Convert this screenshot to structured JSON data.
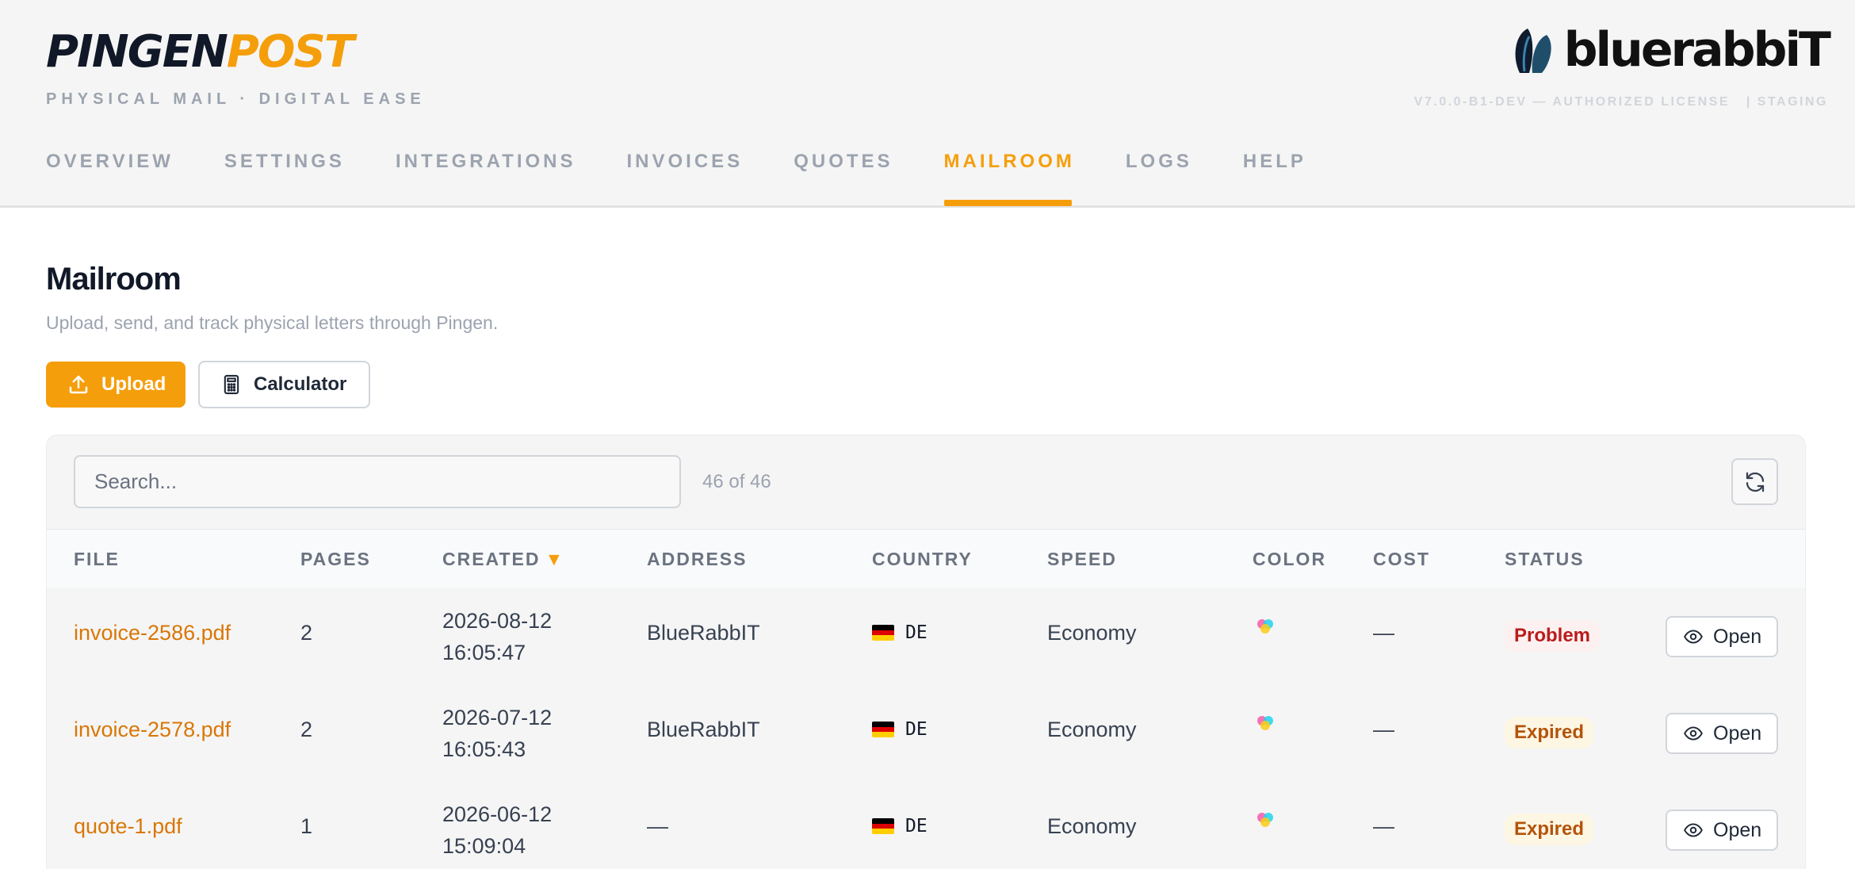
{
  "brand": {
    "part1": "PINGEN",
    "part2": "POST",
    "tagline": "PHYSICAL MAIL · DIGITAL EASE"
  },
  "logo": {
    "text": "bluerabbiT"
  },
  "version": "V7.0.0-B1-DEV — AUTHORIZED LICENSE   | STAGING",
  "nav": {
    "items": [
      "OVERVIEW",
      "SETTINGS",
      "INTEGRATIONS",
      "INVOICES",
      "QUOTES",
      "MAILROOM",
      "LOGS",
      "HELP"
    ],
    "active": "MAILROOM"
  },
  "page": {
    "title": "Mailroom",
    "subtitle": "Upload, send, and track physical letters through Pingen.",
    "upload_label": "Upload",
    "calculator_label": "Calculator"
  },
  "search": {
    "placeholder": "Search...",
    "count": "46 of 46"
  },
  "table": {
    "columns": [
      "FILE",
      "PAGES",
      "CREATED",
      "ADDRESS",
      "COUNTRY",
      "SPEED",
      "COLOR",
      "COST",
      "STATUS"
    ],
    "sort_indicator": "▼",
    "open_label": "Open",
    "rows": [
      {
        "file": "invoice-2586.pdf",
        "pages": "2",
        "created_date": "2026-08-12",
        "created_time": "16:05:47",
        "address": "BlueRabbIT",
        "country": "DE",
        "speed": "Economy",
        "cost": "—",
        "status": "Problem",
        "status_type": "problem"
      },
      {
        "file": "invoice-2578.pdf",
        "pages": "2",
        "created_date": "2026-07-12",
        "created_time": "16:05:43",
        "address": "BlueRabbIT",
        "country": "DE",
        "speed": "Economy",
        "cost": "—",
        "status": "Expired",
        "status_type": "expired"
      },
      {
        "file": "quote-1.pdf",
        "pages": "1",
        "created_date": "2026-06-12",
        "created_time": "15:09:04",
        "address": "—",
        "country": "DE",
        "speed": "Economy",
        "cost": "—",
        "status": "Expired",
        "status_type": "expired"
      }
    ]
  },
  "colors": {
    "accent": "#f59e0b",
    "problem": "#b91c1c",
    "expired": "#b45309"
  },
  "icons": {
    "upload": "upload-icon",
    "calculator": "calculator-icon",
    "refresh": "refresh-icon",
    "open": "eye-icon",
    "color": "color-dots-icon",
    "flag": "flag-de-icon",
    "logo": "rabbit-logo-icon"
  }
}
